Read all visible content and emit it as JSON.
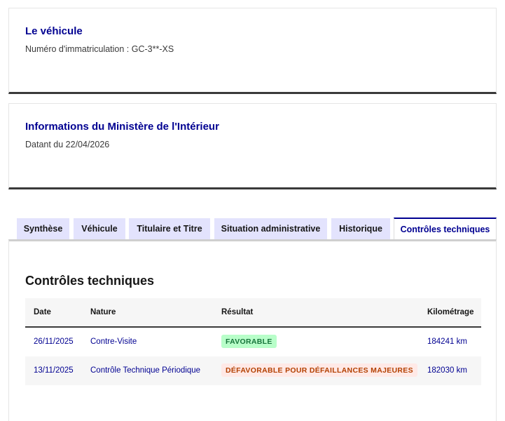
{
  "vehicle_card": {
    "title": "Le véhicule",
    "plate": "Numéro d'immatriculation : GC-3**-XS"
  },
  "ministry_card": {
    "title": "Informations du Ministère de l'Intérieur",
    "date": "Datant du 22/04/2026"
  },
  "tabs": [
    {
      "label": "Synthèse",
      "active": false
    },
    {
      "label": "Véhicule",
      "active": false
    },
    {
      "label": "Titulaire et Titre",
      "active": false
    },
    {
      "label": "Situation administrative",
      "active": false
    },
    {
      "label": "Historique",
      "active": false
    },
    {
      "label": "Contrôles techniques",
      "active": true
    }
  ],
  "panel": {
    "title": "Contrôles techniques",
    "columns": [
      "Date",
      "Nature",
      "Résultat",
      "Kilométrage"
    ],
    "rows": [
      {
        "date": "26/11/2025",
        "nature": "Contre-Visite",
        "result": "FAVORABLE",
        "result_status": "success",
        "km": "184241 km"
      },
      {
        "date": "13/11/2025",
        "nature": "Contrôle Technique Périodique",
        "result": "DÉFAVORABLE POUR DÉFAILLANCES MAJEURES",
        "result_status": "error",
        "km": "182030 km"
      }
    ]
  },
  "colors": {
    "accent": "#000091",
    "tab_bg": "#e3e3fd",
    "success_bg": "#b8fec9",
    "success_text": "#18753c",
    "error_bg": "#ffe9e6",
    "error_text": "#b34000"
  }
}
